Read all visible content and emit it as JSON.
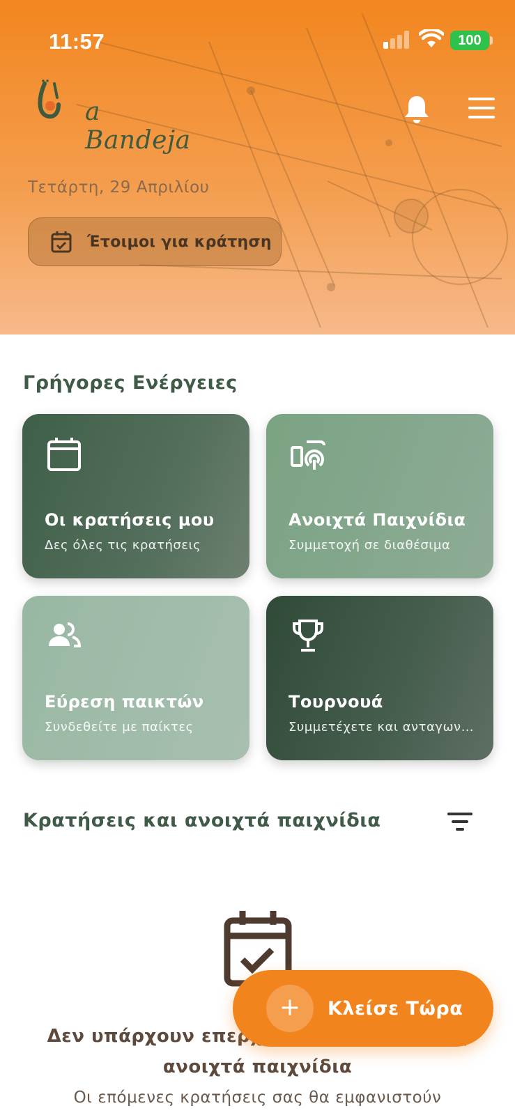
{
  "status_bar": {
    "time": "11:57",
    "battery": "100",
    "battery_color": "#2fc24a"
  },
  "header": {
    "logo_text": "a Bandeja",
    "date": "Τετάρτη, 29 Απριλίου",
    "ready_button_label": "Έτοιμοι για κράτηση",
    "icons": [
      "bell-icon",
      "menu-icon",
      "calendar-check-icon"
    ]
  },
  "quick_actions": {
    "title": "Γρήγορες Ενέργειες",
    "cards": [
      {
        "icon": "calendar-icon",
        "title": "Οι κρατήσεις μου",
        "subtitle": "Δες όλες τις κρατήσεις"
      },
      {
        "icon": "court-broadcast-icon",
        "title": "Ανοιχτά Παιχνίδια",
        "subtitle": "Συμμετοχή σε διαθέσιμα"
      },
      {
        "icon": "users-icon",
        "title": "Εύρεση παικτών",
        "subtitle": "Συνδεθείτε με παίκτες"
      },
      {
        "icon": "trophy-icon",
        "title": "Τουρνουά",
        "subtitle": "Συμμετέχετε και ανταγωνιστείτε"
      }
    ]
  },
  "reservations": {
    "title": "Κρατήσεις και ανοιχτά παιχνίδια",
    "empty_title": "Δεν υπάρχουν επερχόμενες κρατήσεις ή ανοιχτά παιχνίδια",
    "empty_subtitle": "Οι επόμενες κρατήσεις σας θα εμφανιστούν"
  },
  "fab": {
    "label": "Κλείσε Τώρα"
  },
  "colors": {
    "brand_orange": "#f2841d",
    "brand_green": "#3f5a46"
  }
}
